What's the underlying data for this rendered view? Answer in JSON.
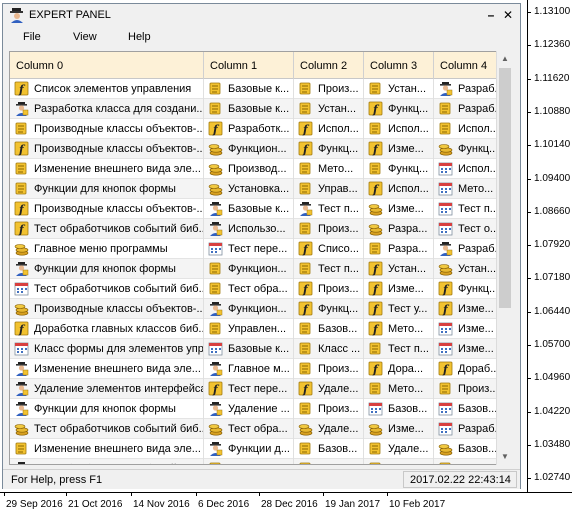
{
  "window": {
    "title": "EXPERT PANEL",
    "minimize_glyph": "–",
    "close_glyph": "✕",
    "icon": "expert-user-icon"
  },
  "menu": [
    "File",
    "View",
    "Help"
  ],
  "table": {
    "columns": [
      "Column 0",
      "Column 1",
      "Column 2",
      "Column 3",
      "Column 4"
    ],
    "rows": [
      [
        [
          "f-scroll",
          "Список элементов управления"
        ],
        [
          "scroll",
          "Базовые к..."
        ],
        [
          "scroll",
          "Произ..."
        ],
        [
          "scroll",
          "Устан..."
        ],
        [
          "user",
          "Разраб..."
        ]
      ],
      [
        [
          "user",
          "Разработка класса для создани..."
        ],
        [
          "scroll",
          "Базовые к..."
        ],
        [
          "scroll",
          "Устан..."
        ],
        [
          "f",
          "Функц..."
        ],
        [
          "scroll",
          "Разраб..."
        ]
      ],
      [
        [
          "scroll",
          "Производные классы объектов-..."
        ],
        [
          "f",
          "Разработк..."
        ],
        [
          "f",
          "Испол..."
        ],
        [
          "scroll",
          "Испол..."
        ],
        [
          "scroll",
          "Испол..."
        ]
      ],
      [
        [
          "f",
          "Производные классы объектов-..."
        ],
        [
          "coins",
          "Функцион..."
        ],
        [
          "f",
          "Функц..."
        ],
        [
          "f",
          "Изме..."
        ],
        [
          "coins",
          "Функц..."
        ]
      ],
      [
        [
          "scroll",
          "Изменение внешнего вида эле..."
        ],
        [
          "coins",
          "Производ..."
        ],
        [
          "scroll",
          "Мето..."
        ],
        [
          "scroll",
          "Функц..."
        ],
        [
          "calendar",
          "Испол..."
        ]
      ],
      [
        [
          "scroll",
          "Функции для кнопок формы"
        ],
        [
          "coins",
          "Установка..."
        ],
        [
          "scroll",
          "Управ..."
        ],
        [
          "f",
          "Испол..."
        ],
        [
          "calendar",
          "Мето..."
        ]
      ],
      [
        [
          "f",
          "Производные классы объектов-..."
        ],
        [
          "user",
          "Базовые к..."
        ],
        [
          "user",
          "Тест п..."
        ],
        [
          "coins",
          "Изме..."
        ],
        [
          "calendar",
          "Тест п..."
        ]
      ],
      [
        [
          "f",
          "Тест обработчиков событий биб..."
        ],
        [
          "user",
          "Использо..."
        ],
        [
          "scroll",
          "Произ..."
        ],
        [
          "coins",
          "Разра..."
        ],
        [
          "calendar",
          "Тест о..."
        ]
      ],
      [
        [
          "coins",
          "Главное меню программы"
        ],
        [
          "calendar",
          "Тест пере..."
        ],
        [
          "f",
          "Списо..."
        ],
        [
          "scroll",
          "Разра..."
        ],
        [
          "user",
          "Разраб..."
        ]
      ],
      [
        [
          "user",
          "Функции для кнопок формы"
        ],
        [
          "scroll",
          "Функцион..."
        ],
        [
          "scroll",
          "Тест п..."
        ],
        [
          "f",
          "Устан..."
        ],
        [
          "coins",
          "Устан..."
        ]
      ],
      [
        [
          "calendar",
          "Тест обработчиков событий биб..."
        ],
        [
          "scroll",
          "Тест обра..."
        ],
        [
          "f",
          "Произ..."
        ],
        [
          "f",
          "Изме..."
        ],
        [
          "f",
          "Функц..."
        ]
      ],
      [
        [
          "coins",
          "Производные классы объектов-..."
        ],
        [
          "user",
          "Функцион..."
        ],
        [
          "f",
          "Функц..."
        ],
        [
          "f",
          "Тест у..."
        ],
        [
          "f",
          "Изме..."
        ]
      ],
      [
        [
          "f",
          "Доработка главных классов биб..."
        ],
        [
          "scroll",
          "Управлен..."
        ],
        [
          "scroll",
          "Базов..."
        ],
        [
          "f",
          "Мето..."
        ],
        [
          "calendar",
          "Изме..."
        ]
      ],
      [
        [
          "calendar",
          "Класс формы для элементов упр..."
        ],
        [
          "calendar",
          "Базовые к..."
        ],
        [
          "scroll",
          "Класс ..."
        ],
        [
          "scroll",
          "Тест п..."
        ],
        [
          "calendar",
          "Изме..."
        ]
      ],
      [
        [
          "user",
          "Изменение внешнего вида эле..."
        ],
        [
          "user",
          "Главное м..."
        ],
        [
          "scroll",
          "Произ..."
        ],
        [
          "f",
          "Дора..."
        ],
        [
          "f",
          "Дораб..."
        ]
      ],
      [
        [
          "user",
          "Удаление элементов интерфейса"
        ],
        [
          "f",
          "Тест пере..."
        ],
        [
          "f",
          "Удале..."
        ],
        [
          "scroll",
          "Мето..."
        ],
        [
          "scroll",
          "Произ..."
        ]
      ],
      [
        [
          "user",
          "Функции для кнопок формы"
        ],
        [
          "user",
          "Удаление ..."
        ],
        [
          "scroll",
          "Произ..."
        ],
        [
          "calendar",
          "Базов..."
        ],
        [
          "calendar",
          "Базов..."
        ]
      ],
      [
        [
          "coins",
          "Тест обработчиков событий биб..."
        ],
        [
          "coins",
          "Тест обра..."
        ],
        [
          "coins",
          "Удале..."
        ],
        [
          "coins",
          "Изме..."
        ],
        [
          "calendar",
          "Разраб..."
        ]
      ],
      [
        [
          "scroll",
          "Изменение внешнего вида эле..."
        ],
        [
          "user",
          "Функции д..."
        ],
        [
          "scroll",
          "Базов..."
        ],
        [
          "scroll",
          "Удале..."
        ],
        [
          "coins",
          "Базов..."
        ]
      ],
      [
        [
          "user",
          "Тест обработчиков событий..."
        ],
        [
          "scroll",
          "Использо..."
        ],
        [
          "scroll",
          "Разра..."
        ],
        [
          "scroll",
          "Тест п..."
        ],
        [
          "scroll",
          "Удале..."
        ]
      ]
    ]
  },
  "status": {
    "help": "For Help, press F1",
    "datetime": "2017.02.22 22:43:14"
  },
  "price_scale": [
    "1.13100",
    "1.12360",
    "1.11620",
    "1.10880",
    "1.10140",
    "1.09400",
    "1.08660",
    "1.07920",
    "1.07180",
    "1.06440",
    "1.05700",
    "1.04960",
    "1.04220",
    "1.03480",
    "1.02740"
  ],
  "time_scale": [
    "29 Sep 2016",
    "21 Oct 2016",
    "14 Nov 2016",
    "6 Dec 2016",
    "28 Dec 2016",
    "19 Jan 2017",
    "10 Feb 2017"
  ],
  "colors": {
    "header_bg": "#fdf1d7",
    "panel_bg": "#f0f0f0",
    "scroll_icon": "#f2c230",
    "coin_icon": "#d8a020",
    "calendar_top": "#d84040"
  }
}
